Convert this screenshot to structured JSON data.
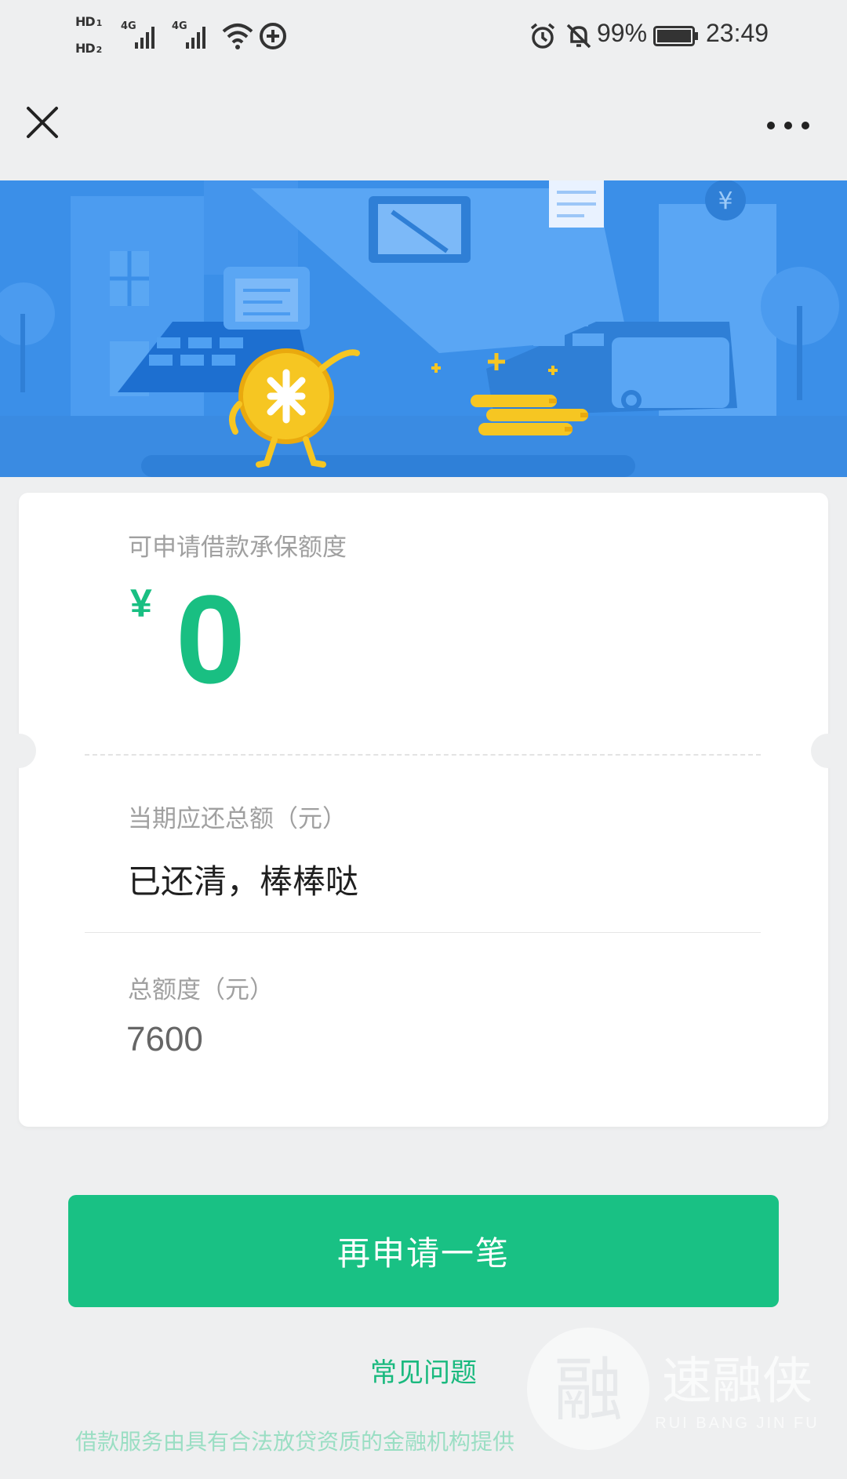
{
  "status_bar": {
    "sim1": "HD",
    "sim1_index": "1",
    "sim2": "HD",
    "sim2_index": "2",
    "network1": "4G",
    "network2": "4G",
    "battery": "99%",
    "time": "23:49"
  },
  "nav": {
    "close_icon": "close-icon",
    "more_icon": "more-horizontal-icon"
  },
  "card": {
    "quota_label": "可申请借款承保额度",
    "quota_currency": "¥",
    "quota_amount": "0",
    "due_label": "当期应还总额（元）",
    "due_value": "已还清，棒棒哒",
    "total_label": "总额度（元）",
    "total_value": "7600"
  },
  "actions": {
    "reapply_button": "再申请一笔",
    "faq_link": "常见问题"
  },
  "footer": {
    "notice": "借款服务由具有合法放贷资质的金融机构提供"
  },
  "watermark": {
    "icon_char": "融",
    "brand": "速融侠",
    "brand_en": "RUI BANG JIN FU"
  },
  "colors": {
    "accent": "#19c184",
    "amount_green": "#19bf82",
    "banner_blue": "#3a8fe6"
  }
}
